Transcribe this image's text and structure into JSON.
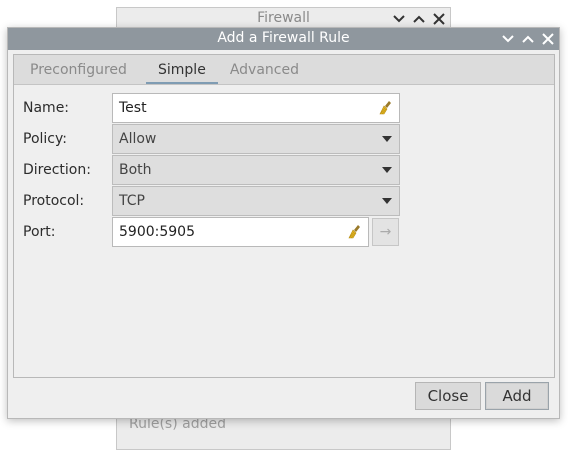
{
  "background_window": {
    "title": "Firewall",
    "status": "Rule(s) added"
  },
  "dialog": {
    "title": "Add a Firewall Rule",
    "tabs": [
      {
        "label": "Preconfigured",
        "active": false
      },
      {
        "label": "Simple",
        "active": true
      },
      {
        "label": "Advanced",
        "active": false
      }
    ],
    "form": {
      "name": {
        "label": "Name:",
        "value": "Test"
      },
      "policy": {
        "label": "Policy:",
        "value": "Allow"
      },
      "direction": {
        "label": "Direction:",
        "value": "Both"
      },
      "protocol": {
        "label": "Protocol:",
        "value": "TCP"
      },
      "port": {
        "label": "Port:",
        "value": "5900:5905",
        "apply_glyph": "→"
      }
    },
    "buttons": {
      "close": "Close",
      "add": "Add"
    }
  },
  "colors": {
    "titlebar_active": "#8f979e",
    "tab_underline": "#7f9cb3"
  }
}
